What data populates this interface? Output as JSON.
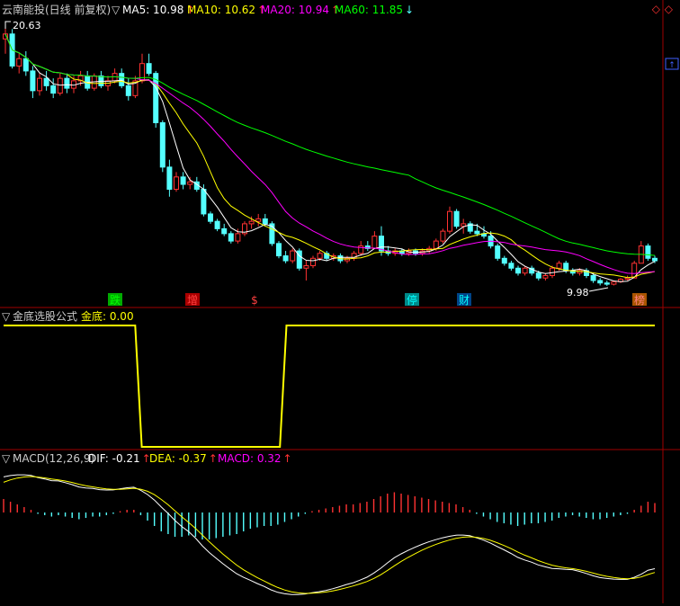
{
  "panels": {
    "main": {
      "stock": "云南能投(日线 前复权)",
      "indicators": [
        {
          "label": "MA5: 10.98",
          "color": "#ffffff",
          "arrow": "up"
        },
        {
          "label": "MA10: 10.62",
          "color": "#ffff00",
          "arrow": "up"
        },
        {
          "label": "MA20: 10.94",
          "color": "#ff00ff",
          "arrow": "up"
        },
        {
          "label": "MA60: 11.85",
          "color": "#00ff00",
          "arrow": "down"
        }
      ],
      "price_high_label": "20.63",
      "price_low_label": "9.98",
      "event_markers": [
        {
          "text": "跌",
          "color": "#00ff00",
          "bg": "#00aa00"
        },
        {
          "text": "增",
          "color": "#ff4040",
          "bg": "#aa0000"
        },
        {
          "text": "$",
          "color": "#ff4040",
          "bg": ""
        },
        {
          "text": "停",
          "color": "#00ffff",
          "bg": "#008888"
        },
        {
          "text": "财",
          "color": "#00ffff",
          "bg": "#004488"
        },
        {
          "text": "榜",
          "color": "#ff8080",
          "bg": "#aa5500"
        }
      ]
    },
    "formula": {
      "title": "金底选股公式",
      "label": "金底: 0.00",
      "color": "#ffff00"
    },
    "macd": {
      "title": "MACD(12,26,9)",
      "indicators": [
        {
          "label": "DIF: -0.21",
          "color": "#ffffff",
          "arrow": "up"
        },
        {
          "label": "DEA: -0.37",
          "color": "#ffff00",
          "arrow": "up"
        },
        {
          "label": "MACD: 0.32",
          "color": "#ff00ff",
          "arrow": "up"
        }
      ]
    }
  },
  "colors": {
    "up": "#ff3232",
    "down": "#54ffff",
    "border": "#a00000",
    "ma5": "#ffffff",
    "ma10": "#ffff00",
    "ma20": "#ff00ff",
    "ma60": "#00ff00"
  },
  "chart_data": [
    {
      "type": "candlestick",
      "title": "云南能投(日线 前复权)",
      "price_range": [
        9.98,
        20.63
      ],
      "ohlc": [
        [
          20.0,
          20.63,
          19.4,
          20.2
        ],
        [
          20.2,
          20.4,
          18.8,
          18.9
        ],
        [
          18.9,
          19.4,
          18.6,
          19.2
        ],
        [
          19.2,
          19.5,
          18.5,
          18.7
        ],
        [
          18.7,
          18.9,
          17.6,
          17.9
        ],
        [
          17.9,
          18.6,
          17.7,
          18.4
        ],
        [
          18.4,
          18.7,
          17.9,
          18.1
        ],
        [
          18.1,
          18.4,
          17.6,
          17.8
        ],
        [
          17.8,
          18.6,
          17.7,
          18.4
        ],
        [
          18.4,
          18.6,
          17.8,
          18.0
        ],
        [
          18.0,
          18.5,
          17.8,
          18.3
        ],
        [
          18.3,
          18.7,
          18.1,
          18.5
        ],
        [
          18.5,
          18.7,
          17.9,
          18.0
        ],
        [
          18.0,
          18.6,
          17.9,
          18.5
        ],
        [
          18.5,
          18.7,
          18.0,
          18.1
        ],
        [
          18.1,
          18.5,
          17.9,
          18.3
        ],
        [
          18.3,
          18.8,
          18.2,
          18.6
        ],
        [
          18.6,
          18.8,
          18.0,
          18.1
        ],
        [
          18.1,
          18.4,
          17.5,
          17.7
        ],
        [
          17.7,
          18.5,
          17.6,
          18.3
        ],
        [
          18.3,
          19.4,
          18.2,
          19.0
        ],
        [
          19.0,
          19.4,
          18.5,
          18.6
        ],
        [
          18.6,
          18.7,
          16.4,
          16.6
        ],
        [
          16.6,
          16.7,
          14.6,
          14.8
        ],
        [
          14.8,
          15.1,
          13.6,
          13.9
        ],
        [
          13.9,
          14.6,
          13.8,
          14.4
        ],
        [
          14.4,
          14.6,
          13.9,
          14.1
        ],
        [
          14.1,
          14.4,
          13.9,
          14.2
        ],
        [
          14.2,
          14.4,
          13.8,
          13.9
        ],
        [
          13.9,
          14.1,
          12.8,
          12.9
        ],
        [
          12.9,
          13.0,
          12.5,
          12.6
        ],
        [
          12.6,
          12.7,
          12.2,
          12.3
        ],
        [
          12.3,
          12.5,
          12.0,
          12.1
        ],
        [
          12.1,
          12.2,
          11.7,
          11.8
        ],
        [
          11.8,
          12.3,
          11.7,
          12.1
        ],
        [
          12.1,
          12.6,
          12.0,
          12.5
        ],
        [
          12.5,
          12.8,
          12.3,
          12.6
        ],
        [
          12.6,
          12.9,
          12.4,
          12.7
        ],
        [
          12.7,
          12.9,
          12.4,
          12.5
        ],
        [
          12.5,
          12.6,
          11.6,
          11.7
        ],
        [
          11.7,
          11.8,
          11.1,
          11.2
        ],
        [
          11.2,
          11.4,
          10.9,
          11.0
        ],
        [
          11.0,
          11.5,
          10.9,
          11.4
        ],
        [
          11.4,
          11.5,
          10.6,
          10.7
        ],
        [
          10.7,
          11.0,
          10.2,
          10.8
        ],
        [
          10.8,
          11.2,
          10.7,
          11.1
        ],
        [
          11.1,
          11.4,
          11.0,
          11.3
        ],
        [
          11.3,
          11.4,
          11.0,
          11.1
        ],
        [
          11.1,
          11.3,
          11.0,
          11.2
        ],
        [
          11.2,
          11.3,
          10.9,
          11.0
        ],
        [
          11.0,
          11.2,
          10.9,
          11.1
        ],
        [
          11.1,
          11.4,
          11.0,
          11.3
        ],
        [
          11.3,
          11.8,
          11.2,
          11.6
        ],
        [
          11.6,
          11.8,
          11.4,
          11.5
        ],
        [
          11.5,
          12.2,
          11.5,
          12.0
        ],
        [
          12.0,
          12.4,
          11.2,
          11.4
        ],
        [
          11.4,
          11.6,
          11.2,
          11.3
        ],
        [
          11.3,
          11.5,
          11.2,
          11.4
        ],
        [
          11.4,
          11.5,
          11.2,
          11.3
        ],
        [
          11.3,
          11.5,
          11.2,
          11.4
        ],
        [
          11.4,
          11.5,
          11.2,
          11.3
        ],
        [
          11.3,
          11.5,
          11.2,
          11.4
        ],
        [
          11.4,
          11.6,
          11.3,
          11.5
        ],
        [
          11.5,
          11.9,
          11.4,
          11.8
        ],
        [
          11.8,
          12.3,
          11.7,
          12.2
        ],
        [
          12.2,
          13.2,
          12.1,
          13.0
        ],
        [
          13.0,
          13.1,
          12.3,
          12.4
        ],
        [
          12.4,
          12.7,
          12.1,
          12.5
        ],
        [
          12.5,
          12.6,
          12.1,
          12.2
        ],
        [
          12.2,
          12.5,
          12.0,
          12.1
        ],
        [
          12.1,
          12.4,
          11.9,
          12.0
        ],
        [
          12.0,
          12.2,
          11.5,
          11.6
        ],
        [
          11.6,
          11.7,
          11.0,
          11.1
        ],
        [
          11.1,
          11.2,
          10.8,
          10.9
        ],
        [
          10.9,
          11.0,
          10.6,
          10.7
        ],
        [
          10.7,
          10.8,
          10.4,
          10.5
        ],
        [
          10.5,
          10.8,
          10.4,
          10.7
        ],
        [
          10.7,
          10.8,
          10.4,
          10.5
        ],
        [
          10.5,
          10.6,
          10.2,
          10.3
        ],
        [
          10.3,
          10.5,
          10.2,
          10.4
        ],
        [
          10.4,
          10.8,
          10.3,
          10.7
        ],
        [
          10.7,
          11.0,
          10.6,
          10.9
        ],
        [
          10.9,
          11.0,
          10.5,
          10.6
        ],
        [
          10.6,
          10.7,
          10.4,
          10.5
        ],
        [
          10.5,
          10.7,
          10.4,
          10.6
        ],
        [
          10.6,
          10.7,
          10.3,
          10.4
        ],
        [
          10.4,
          10.5,
          10.1,
          10.2
        ],
        [
          10.2,
          10.3,
          10.0,
          10.1
        ],
        [
          10.1,
          10.2,
          9.98,
          10.05
        ],
        [
          10.05,
          10.2,
          10.0,
          10.15
        ],
        [
          10.15,
          10.3,
          10.1,
          10.25
        ],
        [
          10.25,
          10.4,
          10.2,
          10.3
        ],
        [
          10.3,
          11.0,
          10.3,
          10.9
        ],
        [
          10.9,
          11.8,
          10.9,
          11.6
        ],
        [
          11.6,
          11.7,
          11.0,
          11.1
        ],
        [
          11.1,
          11.2,
          10.9,
          11.0
        ]
      ],
      "series": [
        {
          "name": "MA5",
          "last": 10.98
        },
        {
          "name": "MA10",
          "last": 10.62
        },
        {
          "name": "MA20",
          "last": 10.94
        },
        {
          "name": "MA60",
          "last": 11.85
        }
      ]
    },
    {
      "type": "line",
      "title": "金底选股公式",
      "series": [
        {
          "name": "金底",
          "values": [
            1,
            1,
            1,
            1,
            1,
            1,
            1,
            1,
            1,
            1,
            1,
            1,
            1,
            1,
            1,
            1,
            1,
            1,
            1,
            1,
            1,
            0,
            0,
            0,
            0,
            0,
            0,
            0,
            0,
            0,
            0,
            0,
            0,
            0,
            0,
            0,
            0,
            0,
            0,
            0,
            0,
            0,
            0,
            1,
            1,
            1,
            1,
            1,
            1,
            1,
            1,
            1,
            1,
            1,
            1,
            1,
            1,
            1,
            1,
            1,
            1,
            1,
            1,
            1,
            1,
            1,
            1,
            1,
            1,
            1,
            1,
            1,
            1,
            1,
            1,
            1,
            1,
            1,
            1,
            1,
            1,
            1,
            1,
            1,
            1,
            1,
            1,
            1,
            1,
            1,
            1,
            1,
            1,
            1,
            1,
            1,
            1,
            1,
            1,
            1
          ]
        }
      ]
    },
    {
      "type": "macd",
      "title": "MACD(12,26,9)",
      "series": [
        {
          "name": "DIF",
          "last": -0.21
        },
        {
          "name": "DEA",
          "last": -0.37
        },
        {
          "name": "MACD",
          "last": 0.32
        }
      ],
      "histogram": [
        0.1,
        0.08,
        0.06,
        0.04,
        0.02,
        -0.01,
        -0.02,
        -0.03,
        -0.02,
        -0.03,
        -0.04,
        -0.05,
        -0.04,
        -0.03,
        -0.03,
        -0.02,
        -0.01,
        0.01,
        0.02,
        0.02,
        -0.02,
        -0.06,
        -0.1,
        -0.14,
        -0.16,
        -0.18,
        -0.18,
        -0.17,
        -0.18,
        -0.2,
        -0.2,
        -0.19,
        -0.18,
        -0.17,
        -0.16,
        -0.14,
        -0.12,
        -0.11,
        -0.1,
        -0.1,
        -0.09,
        -0.07,
        -0.05,
        -0.03,
        -0.01,
        0.01,
        0.02,
        0.03,
        0.04,
        0.05,
        0.06,
        0.06,
        0.07,
        0.08,
        0.1,
        0.12,
        0.14,
        0.15,
        0.14,
        0.13,
        0.12,
        0.11,
        0.1,
        0.09,
        0.08,
        0.07,
        0.06,
        0.04,
        0.02,
        -0.01,
        -0.03,
        -0.05,
        -0.07,
        -0.08,
        -0.09,
        -0.1,
        -0.09,
        -0.08,
        -0.08,
        -0.07,
        -0.06,
        -0.04,
        -0.03,
        -0.02,
        -0.03,
        -0.04,
        -0.05,
        -0.05,
        -0.04,
        -0.03,
        -0.02,
        -0.01,
        0.02,
        0.05,
        0.08,
        0.07
      ]
    }
  ]
}
